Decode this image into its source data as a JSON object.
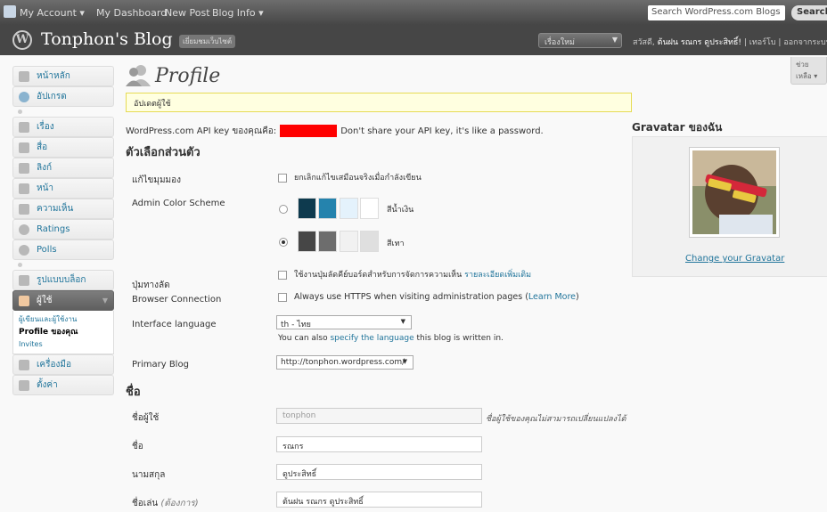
{
  "adminbar": {
    "my_account": "My Account ▾",
    "my_dashboard": "My Dashboard",
    "new_post": "New Post",
    "blog_info": "Blog Info ▾",
    "search_placeholder": "Search WordPress.com Blogs",
    "search_button": "Search"
  },
  "header": {
    "blog_title": "Tonphon's Blog",
    "visit_site": "เยี่ยมชมเว็บไซต์",
    "new_button": "เรื่องใหม่",
    "greeting_prefix": "สวัสดี,",
    "user": "ต้นฝน รณกร ดูประสิทธิ์!",
    "links": "| เทอร์โบ | ออกจากระบบ"
  },
  "help_tab": "ช่วยเหลือ ▾",
  "menu": {
    "items": [
      "หน้าหลัก",
      "อัปเกรด",
      "เรื่อง",
      "สื่อ",
      "ลิงก์",
      "หน้า",
      "ความเห็น",
      "Ratings",
      "Polls",
      "รูปแบบบล็อก",
      "ผู้ใช้",
      "เครื่องมือ",
      "ตั้งค่า"
    ],
    "users_sub": [
      "ผู้เขียนและผู้ใช้งาน",
      "Profile ของคุณ",
      "Invites"
    ]
  },
  "page": {
    "title": "Profile",
    "notice": "อัปเดตผู้ใช้",
    "api_key_prefix": "WordPress.com API key ของคุณคือ:",
    "api_key_suffix": "Don't share your API key, it's like a password.",
    "section_personal": "ตัวเลือกส่วนตัว",
    "section_name": "ชื่อ"
  },
  "form": {
    "visual_editor_label": "แก้ไขมุมมอง",
    "visual_editor_text": "ยกเลิกแก้ไขเสมือนจริงเมื่อกำลังเขียน",
    "color_scheme_label": "Admin Color Scheme",
    "scheme_blue_name": "สีน้ำเงิน",
    "scheme_gray_name": "สีเทา",
    "shortcuts_label": "ปุ่มทางลัด",
    "shortcuts_text": "ใช้งานปุ่มลัดคีย์บอร์ดสำหรับการจัดการความเห็น",
    "shortcuts_link": "รายละเอียดเพิ่มเติม",
    "browser_label": "Browser Connection",
    "browser_text": "Always use HTTPS when visiting administration pages (",
    "browser_link": "Learn More",
    "browser_end": ")",
    "language_label": "Interface language",
    "language_value": "th - ไทย",
    "language_note_prefix": "You can also ",
    "language_note_link": "specify the language",
    "language_note_suffix": " this blog is written in.",
    "primary_blog_label": "Primary Blog",
    "primary_blog_value": "http://tonphon.wordpress.com/",
    "username_label": "ชื่อผู้ใช้",
    "username_value": "tonphon",
    "username_hint": "ชื่อผู้ใช้ของคุณไม่สามารถเปลี่ยนแปลงได้",
    "first_name_label": "ชื่อ",
    "first_name_value": "รณกร",
    "last_name_label": "นามสกุล",
    "last_name_value": "ดูประสิทธิ์",
    "nickname_label": "ชื่อเล่น",
    "nickname_required": "(ต้องการ)",
    "nickname_value": "ต้นฝน รณกร ดูประสิทธิ์"
  },
  "gravatar": {
    "title": "Gravatar ของฉัน",
    "change_link": "Change your Gravatar"
  },
  "colors": {
    "scheme_blue": [
      "#0e3a4e",
      "#2583ad",
      "#e4f2fc",
      "#ffffff"
    ],
    "scheme_gray": [
      "#464646",
      "#6d6d6d",
      "#f1f1f1",
      "#dfdfdf"
    ]
  }
}
